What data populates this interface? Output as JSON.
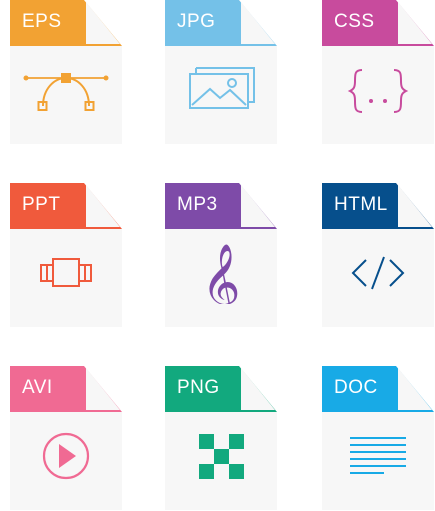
{
  "files": [
    {
      "label": "EPS",
      "color": "#F2A233",
      "icon": "bezier-curve-icon"
    },
    {
      "label": "JPG",
      "color": "#74C1E8",
      "icon": "image-icon"
    },
    {
      "label": "CSS",
      "color": "#C84B9D",
      "icon": "curly-braces-icon"
    },
    {
      "label": "PPT",
      "color": "#F05A3C",
      "icon": "presentation-icon"
    },
    {
      "label": "MP3",
      "color": "#7E4BA8",
      "icon": "treble-clef-icon"
    },
    {
      "label": "HTML",
      "color": "#064F8C",
      "icon": "code-tags-icon"
    },
    {
      "label": "AVI",
      "color": "#F06A93",
      "icon": "play-icon"
    },
    {
      "label": "PNG",
      "color": "#12A97E",
      "icon": "checker-icon"
    },
    {
      "label": "DOC",
      "color": "#18AAE6",
      "icon": "text-lines-icon"
    }
  ],
  "colors": {
    "paper": "#F7F7F7",
    "fold": "#E6E6E6"
  }
}
